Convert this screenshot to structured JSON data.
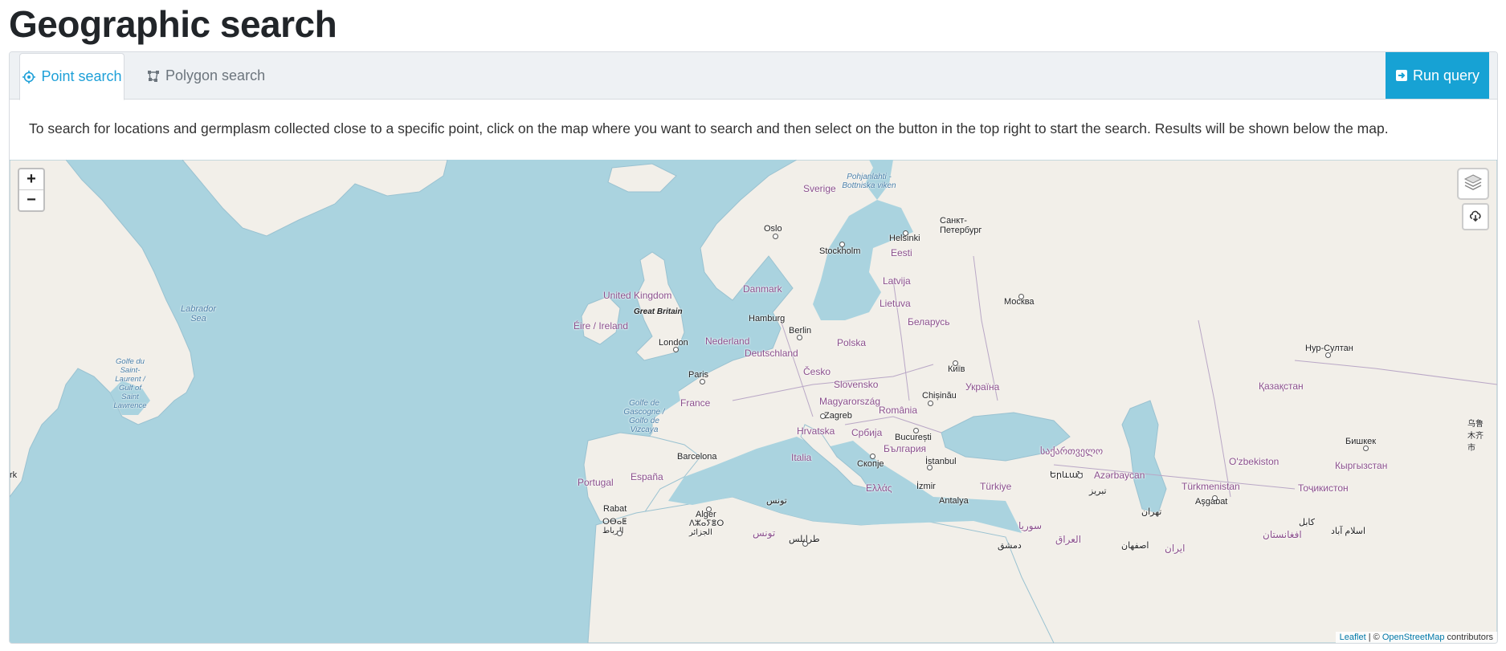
{
  "page": {
    "title": "Geographic search"
  },
  "tabs": [
    {
      "label": "Point search",
      "icon": "crosshair-icon",
      "active": true
    },
    {
      "label": "Polygon search",
      "icon": "polygon-icon",
      "active": false
    }
  ],
  "toolbar": {
    "run_label": "Run query",
    "run_icon": "sign-in-icon"
  },
  "help_text": "To search for locations and germplasm collected close to a specific point, click on the map where you want to search and then select on the button in the top right to start the search. Results will be shown below the map.",
  "map": {
    "zoom_in": "+",
    "zoom_out": "−",
    "attribution": {
      "leaflet": "Leaflet",
      "sep": " | © ",
      "osm": "OpenStreetMap",
      "suffix": " contributors"
    },
    "colors": {
      "water": "#aad3df",
      "land": "#f2efe9",
      "border": "#b9a7c6"
    },
    "labels": {
      "sverige": "Sverige",
      "pohjanlahti": "Pohjanlahti - Bottniska viken",
      "oslo": "Oslo",
      "stockholm": "Stockholm",
      "helsinki": "Helsinki",
      "spb": "Санкт-Петербург",
      "eesti": "Eesti",
      "latvija": "Latvija",
      "lietuva": "Lietuva",
      "danmark": "Danmark",
      "moskva": "Москва",
      "uk": "United Kingdom",
      "gb": "Great Britain",
      "eire": "Éire / Ireland",
      "hamburg": "Hamburg",
      "berlin": "Berlin",
      "nederland": "Nederland",
      "belarus": "Беларусь",
      "polska": "Polska",
      "london": "London",
      "deutschland": "Deutschland",
      "labrador": "Labrador Sea",
      "stlaurent": "Golfe du Saint-Laurent / Gulf of Saint Lawrence",
      "kyiv": "Київ",
      "nursultan": "Нур-Султан",
      "paris": "Paris",
      "cesko": "Česko",
      "slovensko": "Slovensko",
      "ukraina": "Україна",
      "kazakhstan": "Қазақстан",
      "france": "France",
      "magyar": "Magyarország",
      "chisinau": "Chișinău",
      "gascogne": "Golfe de Gascogne / Golfo de Vizcaya",
      "zagreb": "Zagreb",
      "romania": "România",
      "hrvatska": "Hrvatska",
      "srbija": "Србија",
      "bucuresti": "București",
      "urumqi": "乌鲁木齐市",
      "bulgaria": "България",
      "bishkek": "Бишкек",
      "barcelona": "Barcelona",
      "italia": "Italia",
      "skopje": "Скопје",
      "istanbul": "İstanbul",
      "sakartvelo": "საქართველო",
      "uzbekiston": "O'zbekiston",
      "kyrgyzstan": "Кыргызстан",
      "erevan": "Երևան",
      "azerbaycan": "Azərbaycan",
      "portugal": "Portugal",
      "espana": "España",
      "ellas": "Ελλάς",
      "izmir": "İzmir",
      "turkiye": "Türkiye",
      "tabriz": "تبریز",
      "turkmenistan": "Türkmenistan",
      "tojikiston": "Тоҷикистон",
      "antalya": "Antalya",
      "ashgabat": "Aşgabat",
      "tehran": "تهران",
      "rabat": "Rabat",
      "alger": "Alger",
      "tunis": "تونس",
      "rabat_ar": "ⵔⴱⴰⵟ الرباط",
      "alger_ar": "ⴷⵣⴰⵢⴻⵔ الجزائر",
      "tunis2": "تونس",
      "surya": "سوريا",
      "iraq": "العراق",
      "dimashq": "دمشق",
      "iran": "ایران",
      "esfahan": "اصفهان",
      "tarabulus": "طرابلس",
      "kabul": "کابل",
      "islamabad": "اسلام آباد",
      "afghanistan": "افغانستان",
      "rk": "rk"
    }
  }
}
